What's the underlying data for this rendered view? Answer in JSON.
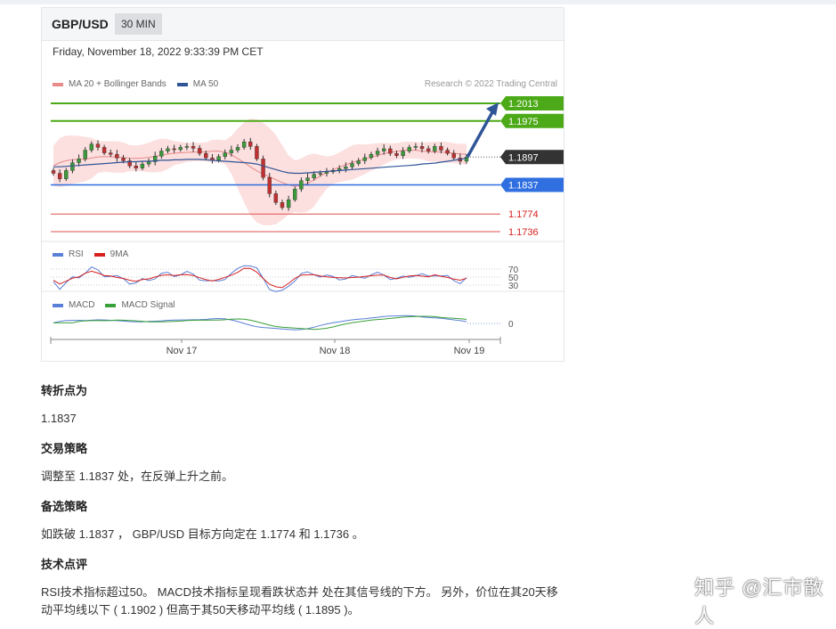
{
  "header": {
    "pair": "GBP/USD",
    "timeframe": "30 MIN"
  },
  "datetime": "Friday, November 18, 2022 9:33:39 PM CET",
  "credit": "Research © 2022 Trading Central",
  "legend_main": [
    {
      "label": "MA 20 + Bollinger Bands",
      "color": "#e88a8a"
    },
    {
      "label": "MA 50",
      "color": "#2f5597"
    }
  ],
  "legend_rsi": [
    {
      "label": "RSI",
      "color": "#5a7fd6"
    },
    {
      "label": "9MA",
      "color": "#d62020"
    }
  ],
  "legend_macd": [
    {
      "label": "MACD",
      "color": "#5a7fd6"
    },
    {
      "label": "MACD Signal",
      "color": "#3aa03a"
    }
  ],
  "colors": {
    "resistance": "#4caa18",
    "pivot": "#2f6fe0",
    "support": "#e05050",
    "current": "#333333",
    "arrow": "#2f5597",
    "bb_fill": "#fbd9d9",
    "candle_up": "#3a9a3a",
    "candle_down": "#c03030"
  },
  "chart_data": {
    "type": "candlestick",
    "instrument": "GBP/USD",
    "timeframe": "30 MIN",
    "x_ticks": [
      "Nov 17",
      "Nov 18",
      "Nov 19"
    ],
    "levels": [
      {
        "value": 1.2013,
        "label": "1.2013",
        "kind": "resistance"
      },
      {
        "value": 1.1975,
        "label": "1.1975",
        "kind": "resistance"
      },
      {
        "value": 1.1897,
        "label": "1.1897",
        "kind": "current"
      },
      {
        "value": 1.1837,
        "label": "1.1837",
        "kind": "pivot"
      },
      {
        "value": 1.1774,
        "label": "1.1774",
        "kind": "support"
      },
      {
        "value": 1.1736,
        "label": "1.1736",
        "kind": "support"
      }
    ],
    "close": [
      1.1862,
      1.185,
      1.1868,
      1.1885,
      1.1893,
      1.1912,
      1.1925,
      1.1918,
      1.1906,
      1.1903,
      1.1895,
      1.1889,
      1.1878,
      1.1873,
      1.1882,
      1.1887,
      1.1899,
      1.191,
      1.1915,
      1.1913,
      1.1918,
      1.192,
      1.1916,
      1.1905,
      1.1895,
      1.189,
      1.1898,
      1.1906,
      1.1912,
      1.1918,
      1.193,
      1.192,
      1.1893,
      1.1853,
      1.1818,
      1.1799,
      1.1788,
      1.1805,
      1.1828,
      1.1846,
      1.1852,
      1.186,
      1.1862,
      1.1865,
      1.1868,
      1.1872,
      1.1876,
      1.1883,
      1.1889,
      1.1896,
      1.1903,
      1.191,
      1.1915,
      1.1905,
      1.19,
      1.191,
      1.1918,
      1.192,
      1.1915,
      1.191,
      1.192,
      1.1912,
      1.1905,
      1.1895,
      1.1888,
      1.1897
    ],
    "ma50": [
      1.1876,
      1.1876,
      1.1877,
      1.1878,
      1.1879,
      1.188,
      1.1881,
      1.1882,
      1.1883,
      1.1884,
      1.1885,
      1.1886,
      1.1887,
      1.1887,
      1.1888,
      1.1888,
      1.1889,
      1.189,
      1.189,
      1.1891,
      1.1891,
      1.1892,
      1.1892,
      1.1892,
      1.1891,
      1.189,
      1.1889,
      1.1888,
      1.1887,
      1.1886,
      1.1885,
      1.1884,
      1.1882,
      1.1878,
      1.1874,
      1.187,
      1.1866,
      1.1863,
      1.1862,
      1.1862,
      1.1863,
      1.1864,
      1.1865,
      1.1866,
      1.1867,
      1.1868,
      1.1869,
      1.187,
      1.1871,
      1.1872,
      1.1873,
      1.1874,
      1.1875,
      1.1876,
      1.1877,
      1.1878,
      1.1879,
      1.188,
      1.1882,
      1.1883,
      1.1884,
      1.1886,
      1.1888,
      1.189,
      1.1892,
      1.1895
    ],
    "forecast_target": 1.2013,
    "rsi_levels": [
      "70",
      "50",
      "30"
    ],
    "macd_levels": [
      "0"
    ]
  },
  "article": [
    {
      "heading": "转折点为",
      "text": "1.1837"
    },
    {
      "heading": "交易策略",
      "text": "调整至 1.1837 处，在反弹上升之前。"
    },
    {
      "heading": "备选策略",
      "text": "如跌破 1.1837 ， GBP/USD 目标方向定在 1.1774 和 1.1736 。"
    },
    {
      "heading": "技术点评",
      "text": "RSI技术指标超过50。 MACD技术指标呈现看跌状态并 处在其信号线的下方。 另外，价位在其20天移动平均线以下 ( 1.1902 ) 但高于其50天移动平均线 ( 1.1895 )。"
    }
  ],
  "watermark": "知乎 @汇市散人"
}
